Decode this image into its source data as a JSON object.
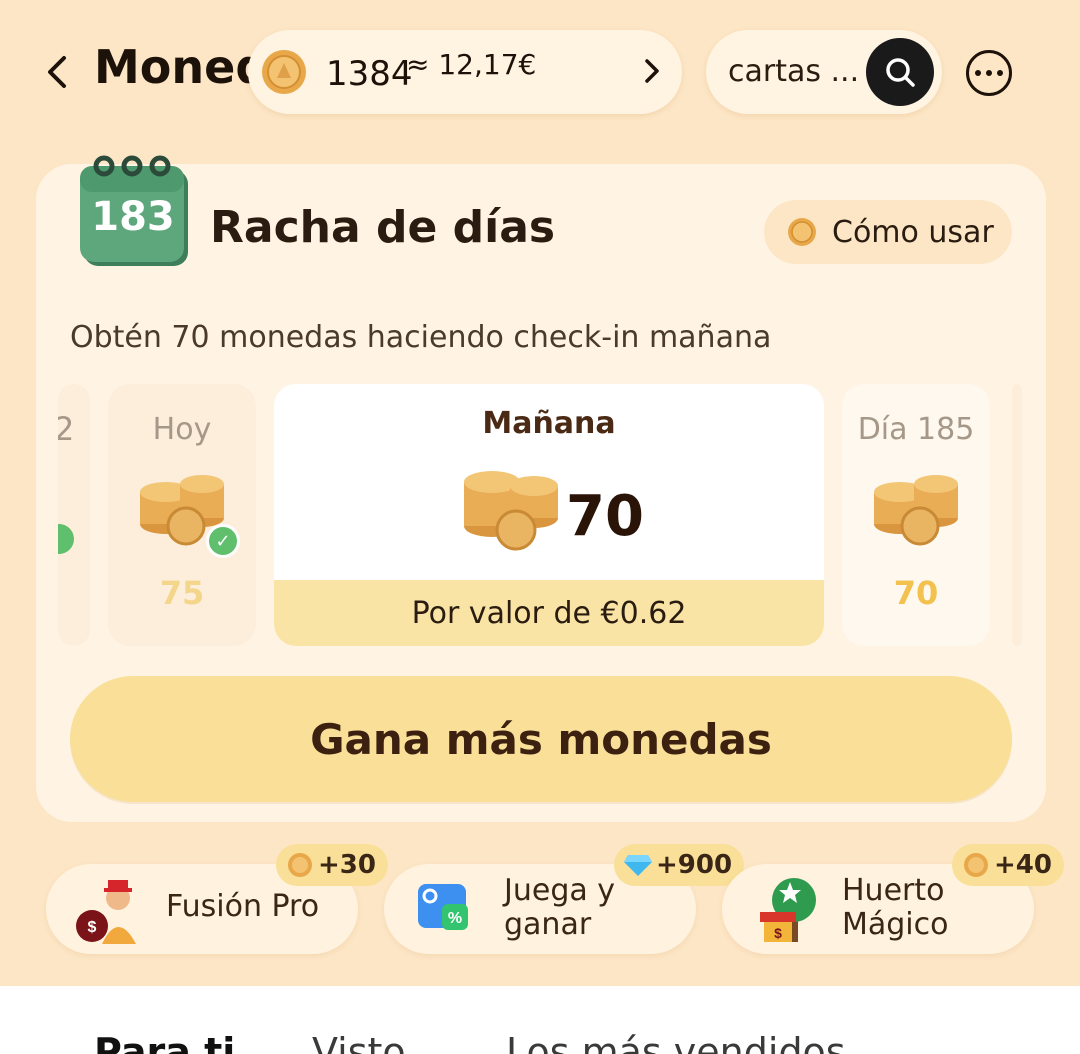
{
  "header": {
    "title": "Monedas",
    "balance": "1384",
    "approx_value": "≈ 12,17€",
    "search_text": "cartas ..."
  },
  "streak": {
    "days_count": "183",
    "title": "Racha de días",
    "how_to_use": "Cómo usar",
    "subtitle": "Obtén 70 monedas haciendo check-in mañana",
    "prev_partial": "2",
    "today": {
      "label": "Hoy",
      "amount": "75",
      "checked": true
    },
    "tomorrow": {
      "label": "Mañana",
      "amount": "70",
      "worth": "Por valor de €0.62"
    },
    "next": {
      "label": "Día 185",
      "amount": "70"
    },
    "earn_more": "Gana más monedas"
  },
  "actions": [
    {
      "label": "Fusión Pro",
      "reward": "+30",
      "reward_icon": "coin-icon"
    },
    {
      "label": "Juega y ganar",
      "reward": "+900",
      "reward_icon": "diamond-icon"
    },
    {
      "label": "Huerto Mágico",
      "reward": "+40",
      "reward_icon": "coin-icon"
    }
  ],
  "tabs": [
    {
      "label": "Para ti",
      "active": true
    },
    {
      "label": "Visto",
      "active": false
    },
    {
      "label": "Los más vendidos",
      "active": false
    }
  ],
  "colors": {
    "background": "#fde6c6",
    "card": "#fff4e4",
    "accent_yellow": "#f9df97",
    "coin_gold": "#e9b052",
    "check_green": "#5fbf6d",
    "calendar_green": "#4e9a6e"
  }
}
